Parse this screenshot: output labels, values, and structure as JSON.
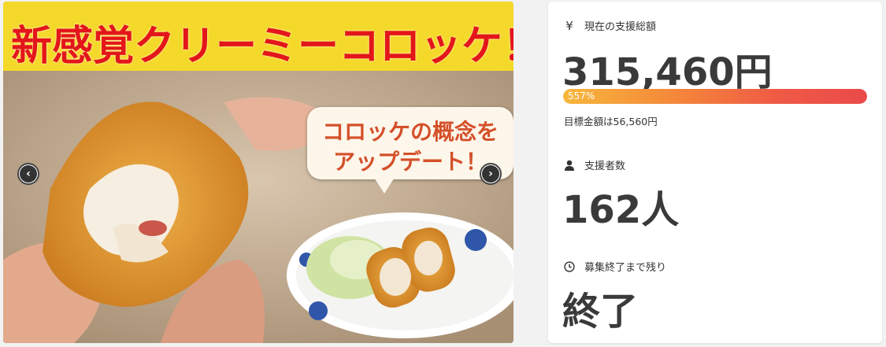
{
  "hero": {
    "banner_text": "新感覚クリーミーコロッケ！",
    "bubble_line1": "コロッケの概念を",
    "bubble_line2": "アップデート！",
    "prev_arrow": "‹",
    "next_arrow": "›"
  },
  "stats": {
    "total": {
      "icon": "yen-icon",
      "icon_glyph": "¥",
      "label": "現在の支援総額",
      "value": "315,460円",
      "progress_text": "557%",
      "progress_fraction": 1.0,
      "goal_text": "目標金額は56,560円"
    },
    "supporters": {
      "icon": "person-icon",
      "label": "支援者数",
      "value": "162人"
    },
    "remaining": {
      "icon": "clock-icon",
      "label": "募集終了まで残り",
      "value": "終了"
    }
  },
  "colors": {
    "banner_bg": "#f5d92a",
    "banner_text": "#e3161a",
    "progress_start": "#f6b73c",
    "progress_end": "#ea4a4a"
  }
}
